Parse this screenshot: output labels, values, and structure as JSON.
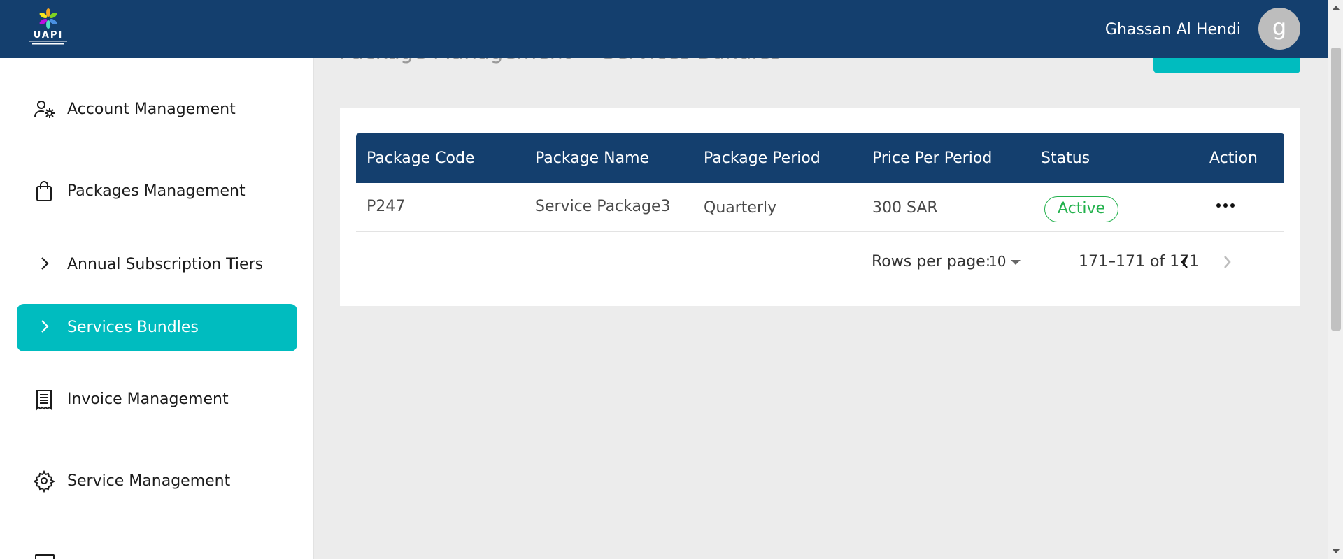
{
  "header": {
    "user_name": "Ghassan Al Hendi",
    "avatar_initial": "g"
  },
  "page": {
    "title": "Package Management > Services Bundles"
  },
  "sidebar": {
    "items": [
      {
        "label": "Account Management",
        "icon": "user-gear-icon",
        "active": false
      },
      {
        "label": "Packages Management",
        "icon": "shopping-bag-icon",
        "active": false
      },
      {
        "label": "Annual Subscription Tiers",
        "icon": "chevron-right-icon",
        "active": false
      },
      {
        "label": "Services Bundles",
        "icon": "chevron-right-icon",
        "active": true
      },
      {
        "label": "Invoice Management",
        "icon": "receipt-icon",
        "active": false
      },
      {
        "label": "Service Management",
        "icon": "gear-icon",
        "active": false
      }
    ]
  },
  "table": {
    "columns": [
      "Package Code",
      "Package Name",
      "Package Period",
      "Price Per Period",
      "Status",
      "Action"
    ],
    "rows": [
      {
        "code": "P247",
        "name": "Service Package3",
        "period": "Quarterly",
        "price": "300 SAR",
        "status": "Active"
      }
    ]
  },
  "pagination": {
    "rows_per_page_label": "Rows per page:",
    "rows_per_page_value": "10",
    "range_text": "171–171 of 171"
  },
  "colors": {
    "header_bg": "#143f6e",
    "accent": "#00bcbf",
    "status_active": "#22b14c"
  }
}
